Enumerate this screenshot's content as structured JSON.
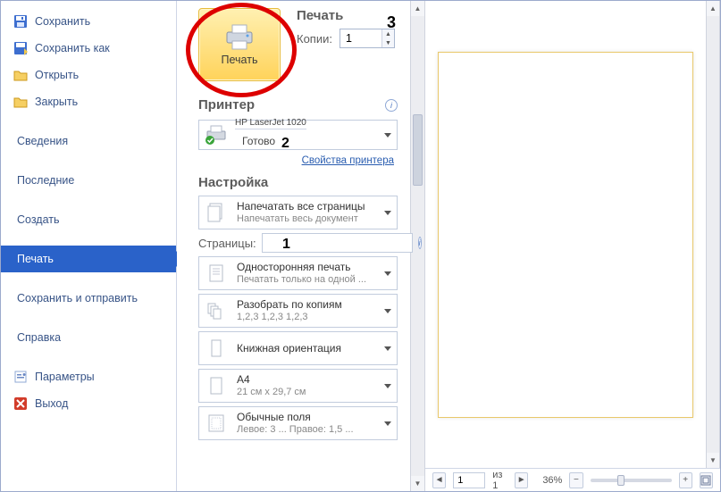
{
  "sidebar": {
    "items": [
      {
        "label": "Сохранить",
        "icon": "save-icon"
      },
      {
        "label": "Сохранить как",
        "icon": "save-as-icon"
      },
      {
        "label": "Открыть",
        "icon": "open-folder-icon"
      },
      {
        "label": "Закрыть",
        "icon": "close-folder-icon"
      }
    ],
    "nav": [
      {
        "label": "Сведения"
      },
      {
        "label": "Последние"
      },
      {
        "label": "Создать"
      },
      {
        "label": "Печать",
        "active": true
      },
      {
        "label": "Сохранить и отправить"
      },
      {
        "label": "Справка"
      }
    ],
    "bottom": [
      {
        "label": "Параметры",
        "icon": "options-icon"
      },
      {
        "label": "Выход",
        "icon": "exit-icon"
      }
    ]
  },
  "print": {
    "sectionTitle": "Печать",
    "buttonLabel": "Печать",
    "copiesLabel": "Копии:",
    "copiesValue": "1",
    "annotation3": "3"
  },
  "printer": {
    "sectionTitle": "Принтер",
    "name": "HP LaserJet 1020",
    "status": "Готово",
    "propertiesLink": "Свойства принтера",
    "annotation2": "2"
  },
  "settings": {
    "sectionTitle": "Настройка",
    "pagesLabel": "Страницы:",
    "pagesValue": "",
    "annotation1": "1",
    "items": {
      "scope": {
        "title": "Напечатать все страницы",
        "sub": "Напечатать весь документ"
      },
      "sides": {
        "title": "Односторонняя печать",
        "sub": "Печатать только на одной ..."
      },
      "collate": {
        "title": "Разобрать по копиям",
        "sub": "1,2,3   1,2,3   1,2,3"
      },
      "orientation": {
        "title": "Книжная ориентация",
        "sub": ""
      },
      "paper": {
        "title": "A4",
        "sub": "21 см x 29,7 см"
      },
      "margins": {
        "title": "Обычные поля",
        "sub": "Левое: 3 ...   Правое: 1,5 ..."
      }
    }
  },
  "status": {
    "currentPage": "1",
    "ofLabel": "из 1",
    "zoomLabel": "36%"
  }
}
